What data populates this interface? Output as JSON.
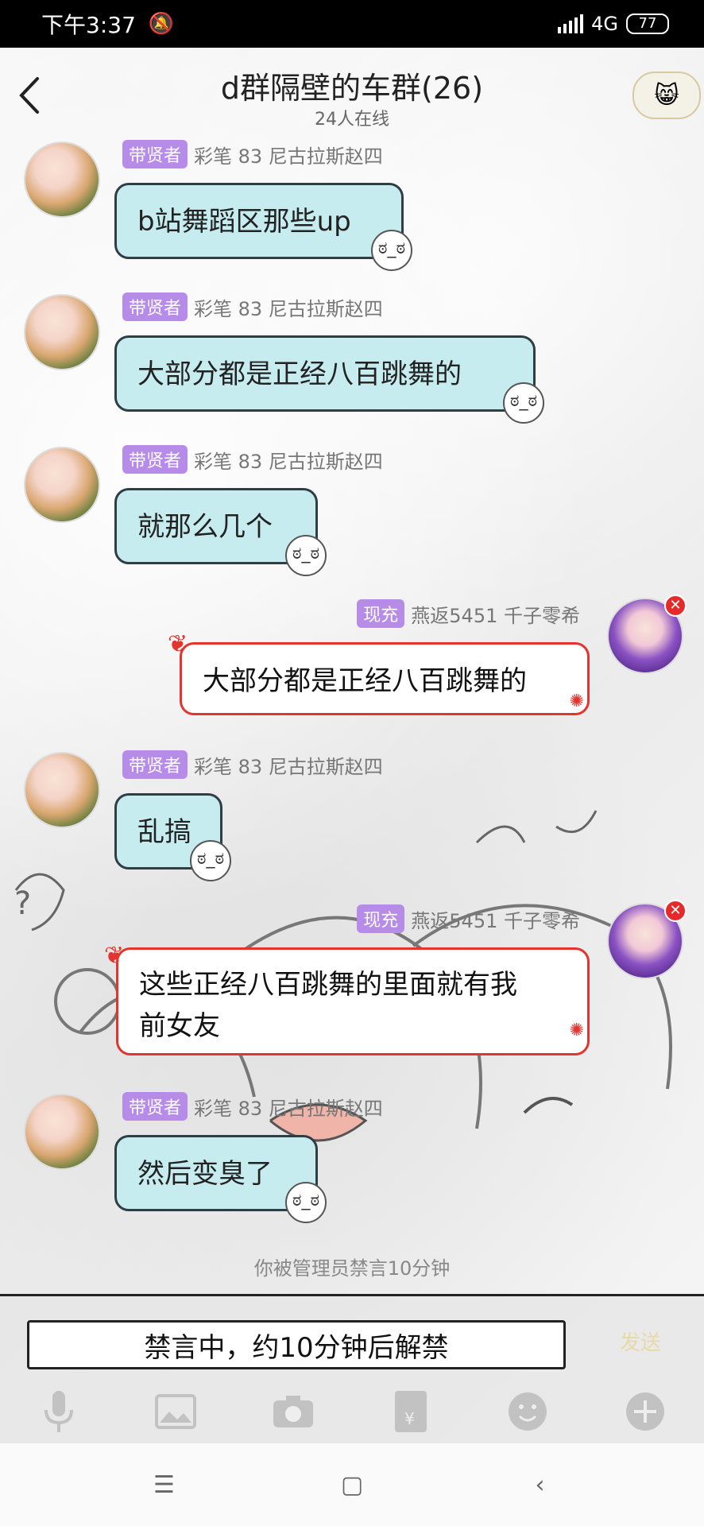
{
  "status_bar": {
    "time": "下午3:37",
    "network": "4G",
    "battery": "77"
  },
  "header": {
    "title": "d群隔壁的车群(26)",
    "subtitle": "24人在线"
  },
  "messages": [
    {
      "side": "left",
      "badge": "带贤者",
      "sender": "彩笔 83 尼古拉斯赵四",
      "text": "b站舞蹈区那些up"
    },
    {
      "side": "left",
      "badge": "带贤者",
      "sender": "彩笔 83 尼古拉斯赵四",
      "text": "大部分都是正经八百跳舞的"
    },
    {
      "side": "left",
      "badge": "带贤者",
      "sender": "彩笔 83 尼古拉斯赵四",
      "text": "就那么几个"
    },
    {
      "side": "right",
      "badge": "现充",
      "sender": "燕返5451 千子零希",
      "text": "大部分都是正经八百跳舞的"
    },
    {
      "side": "left",
      "badge": "带贤者",
      "sender": "彩笔 83 尼古拉斯赵四",
      "text": "乱搞"
    },
    {
      "side": "right",
      "badge": "现充",
      "sender": "燕返5451 千子零希",
      "text_line1": "这些正经八百跳舞的里面就有我",
      "text_line2": "前女友"
    },
    {
      "side": "left",
      "badge": "带贤者",
      "sender": "彩笔 83 尼古拉斯赵四",
      "text": "然后变臭了"
    }
  ],
  "system_message": "你被管理员禁言10分钟",
  "input": {
    "muted_notice": "禁言中，约10分钟后解禁",
    "send_label": "发送"
  },
  "toolbar": [
    "microphone-icon",
    "image-icon",
    "camera-icon",
    "red-packet-icon",
    "emoji-icon",
    "plus-icon"
  ],
  "colors": {
    "bubble_left": "#c6ecef",
    "bubble_right_border": "#e3342f",
    "badge": "#b78be8"
  }
}
